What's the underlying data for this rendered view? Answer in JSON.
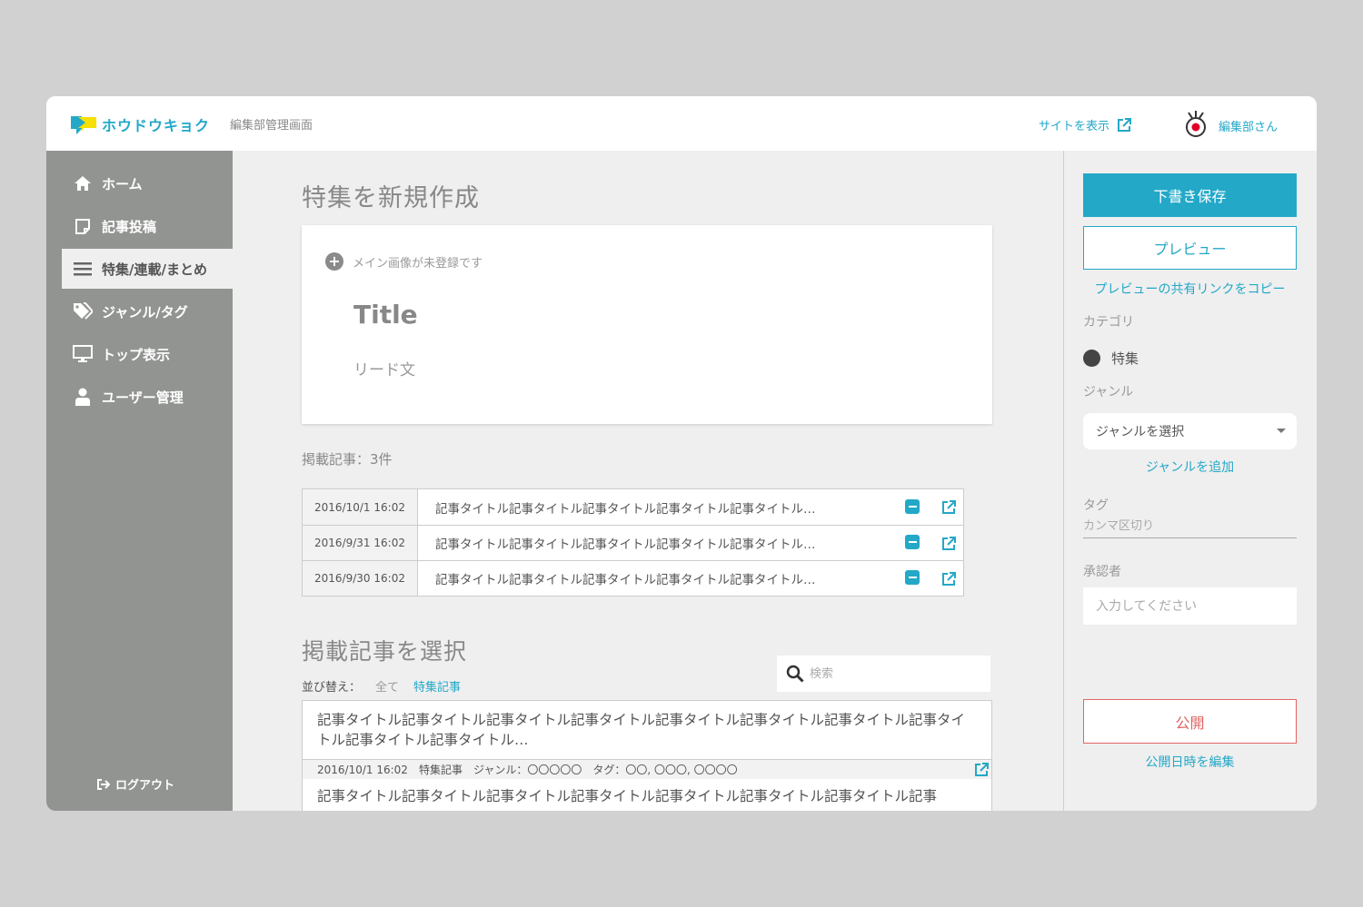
{
  "header": {
    "logo_text": "ホウドウキョク",
    "subtitle": "編集部管理画面",
    "site_link": "サイトを表示",
    "user_name": "編集部さん"
  },
  "sidebar": {
    "items": [
      {
        "label": "ホーム",
        "icon": "home-icon"
      },
      {
        "label": "記事投稿",
        "icon": "note-icon"
      },
      {
        "label": "特集/連載/まとめ",
        "icon": "list-icon",
        "active": true
      },
      {
        "label": "ジャンル/タグ",
        "icon": "tag-icon"
      },
      {
        "label": "トップ表示",
        "icon": "monitor-icon"
      },
      {
        "label": "ユーザー管理",
        "icon": "user-icon"
      }
    ],
    "logout": "ログアウト"
  },
  "main": {
    "page_title": "特集を新規作成",
    "image_prompt": "メイン画像が未登録です",
    "title_placeholder": "Title",
    "lead_placeholder": "リード文",
    "count_label": "掲載記事：3件",
    "articles": [
      {
        "date": "2016/10/1 16:02",
        "title": "記事タイトル記事タイトル記事タイトル記事タイトル記事タイトル…"
      },
      {
        "date": "2016/9/31 16:02",
        "title": "記事タイトル記事タイトル記事タイトル記事タイトル記事タイトル…"
      },
      {
        "date": "2016/9/30 16:02",
        "title": "記事タイトル記事タイトル記事タイトル記事タイトル記事タイトル…"
      }
    ],
    "select_title": "掲載記事を選択",
    "search_placeholder": "検索",
    "sort_label": "並び替え：",
    "sort_all": "全て",
    "sort_feature": "特集記事",
    "results": [
      {
        "text": "記事タイトル記事タイトル記事タイトル記事タイトル記事タイトル記事タイトル記事タイトル記事タイトル記事タイトル記事タイトル…",
        "date": "2016/10/1 16:02",
        "type": "特集記事",
        "genre": "ジャンル：〇〇〇〇〇",
        "tags": "タグ：〇〇, 〇〇〇, 〇〇〇〇"
      },
      {
        "text": "記事タイトル記事タイトル記事タイトル記事タイトル記事タイトル記事タイトル記事タイトル記事"
      }
    ]
  },
  "right": {
    "save_draft": "下書き保存",
    "preview": "プレビュー",
    "copy_preview_link": "プレビューの共有リンクをコピー",
    "category_label": "カテゴリ",
    "category_value": "特集",
    "genre_label": "ジャンル",
    "genre_select": "ジャンルを選択",
    "add_genre": "ジャンルを追加",
    "tag_label": "タグ",
    "tag_placeholder": "カンマ区切り",
    "approver_label": "承認者",
    "approver_placeholder": "入力してください",
    "publish": "公開",
    "edit_publish_date": "公開日時を編集"
  },
  "colors": {
    "accent": "#23a8c8",
    "logo_green": "#8cc63f",
    "sidebar_bg": "#929491",
    "publish_red": "#e06464"
  }
}
